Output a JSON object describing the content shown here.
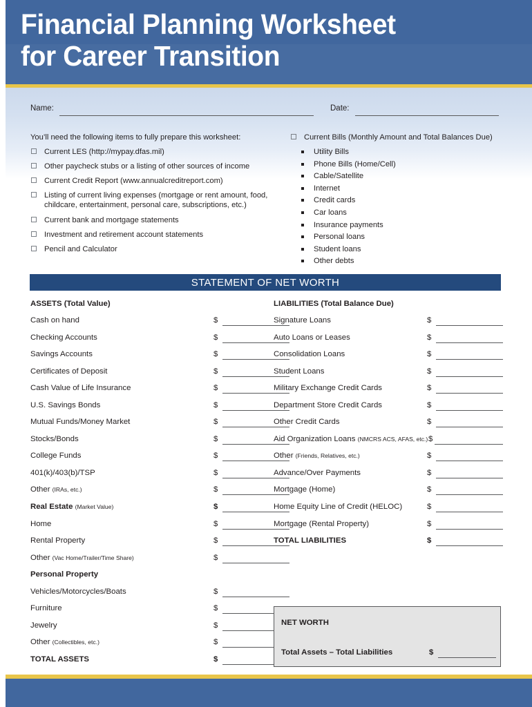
{
  "header": {
    "title": "Financial Planning Worksheet\nfor Career Transition"
  },
  "form_fields": {
    "name_label": "Name:",
    "name_value": "",
    "date_label": "Date:",
    "date_value": ""
  },
  "prep_checklist": {
    "intro": "You’ll need the following items to fully prepare this worksheet:",
    "items": [
      "Current LES (http://mypay.dfas.mil)",
      "Other paycheck stubs or a listing of other sources of income",
      "Current Credit Report (www.annualcreditreport.com)",
      "Listing of current living expenses (mortgage or rent amount, food, childcare, entertainment, personal care, subscriptions, etc.)",
      "Current bank and mortgage statements",
      "Investment and retirement account statements",
      "Pencil and Calculator"
    ]
  },
  "bills_checklist": {
    "heading": "Current Bills (Monthly Amount and Total Balances Due)",
    "items": [
      "Utility Bills",
      "Phone Bills (Home/Cell)",
      "Cable/Satellite",
      "Internet",
      "Credit cards",
      "Car loans",
      "Insurance payments",
      "Personal loans",
      "Student loans",
      "Other debts"
    ]
  },
  "statement": {
    "bar_title": "STATEMENT OF NET WORTH",
    "assets_heading": "ASSETS  (Total Value)",
    "liabilities_heading": "LIABILITIES (Total Balance Due)",
    "currency_symbol": "$",
    "assets_rows": [
      {
        "label": "Cash on hand",
        "note": "",
        "value": "",
        "bold": false,
        "money": true
      },
      {
        "label": "Checking Accounts",
        "note": "",
        "value": "",
        "bold": false,
        "money": true
      },
      {
        "label": "Savings Accounts",
        "note": "",
        "value": "",
        "bold": false,
        "money": true
      },
      {
        "label": "Certificates of Deposit",
        "note": "",
        "value": "",
        "bold": false,
        "money": true
      },
      {
        "label": "Cash Value of Life Insurance",
        "note": "",
        "value": "",
        "bold": false,
        "money": true
      },
      {
        "label": "U.S. Savings Bonds",
        "note": "",
        "value": "",
        "bold": false,
        "money": true
      },
      {
        "label": "Mutual Funds/Money Market",
        "note": "",
        "value": "",
        "bold": false,
        "money": true
      },
      {
        "label": "Stocks/Bonds",
        "note": "",
        "value": "",
        "bold": false,
        "money": true
      },
      {
        "label": "College Funds",
        "note": "",
        "value": "",
        "bold": false,
        "money": true
      },
      {
        "label": "401(k)/403(b)/TSP",
        "note": "",
        "value": "",
        "bold": false,
        "money": true
      },
      {
        "label": "Other ",
        "note": "(IRAs, etc.)",
        "value": "",
        "bold": false,
        "money": true
      },
      {
        "label": "Real Estate ",
        "note": "(Market Value)",
        "value": "",
        "bold": true,
        "money": true
      },
      {
        "label": "Home",
        "note": "",
        "value": "",
        "bold": false,
        "money": true
      },
      {
        "label": "Rental Property",
        "note": "",
        "value": "",
        "bold": false,
        "money": true
      },
      {
        "label": "Other ",
        "note": "(Vac Home/Trailer/Time Share)",
        "value": "",
        "bold": false,
        "money": true
      },
      {
        "label": "Personal Property",
        "note": "",
        "value": "",
        "bold": true,
        "money": false
      },
      {
        "label": "Vehicles/Motorcycles/Boats",
        "note": "",
        "value": "",
        "bold": false,
        "money": true
      },
      {
        "label": "Furniture",
        "note": "",
        "value": "",
        "bold": false,
        "money": true
      },
      {
        "label": "Jewelry",
        "note": "",
        "value": "",
        "bold": false,
        "money": true
      },
      {
        "label": "Other ",
        "note": "(Collectibles, etc.)",
        "value": "",
        "bold": false,
        "money": true
      },
      {
        "label": "TOTAL ASSETS",
        "note": "",
        "value": "",
        "bold": true,
        "money": true
      }
    ],
    "liabilities_rows": [
      {
        "label": "Signature Loans",
        "note": "",
        "value": "",
        "bold": false,
        "money": true,
        "long": false
      },
      {
        "label": "Auto Loans or Leases",
        "note": "",
        "value": "",
        "bold": false,
        "money": true,
        "long": false
      },
      {
        "label": "Consolidation Loans",
        "note": "",
        "value": "",
        "bold": false,
        "money": true,
        "long": false
      },
      {
        "label": "Student Loans",
        "note": "",
        "value": "",
        "bold": false,
        "money": true,
        "long": false
      },
      {
        "label": "Military Exchange Credit Cards",
        "note": "",
        "value": "",
        "bold": false,
        "money": true,
        "long": false
      },
      {
        "label": "Department Store Credit Cards",
        "note": "",
        "value": "",
        "bold": false,
        "money": true,
        "long": false
      },
      {
        "label": "Other Credit Cards",
        "note": "",
        "value": "",
        "bold": false,
        "money": true,
        "long": false
      },
      {
        "label": "Aid Organization Loans ",
        "note": "(NMCRS ACS, AFAS, etc.)",
        "value": "",
        "bold": false,
        "money": true,
        "long": true
      },
      {
        "label": "Other ",
        "note": "(Friends, Relatives, etc.)",
        "value": "",
        "bold": false,
        "money": true,
        "long": false
      },
      {
        "label": "Advance/Over Payments",
        "note": "",
        "value": "",
        "bold": false,
        "money": true,
        "long": false
      },
      {
        "label": "Mortgage (Home)",
        "note": "",
        "value": "",
        "bold": false,
        "money": true,
        "long": false
      },
      {
        "label": "Home Equity Line of Credit (HELOC)",
        "note": "",
        "value": "",
        "bold": false,
        "money": true,
        "long": false
      },
      {
        "label": "Mortgage (Rental Property)",
        "note": "",
        "value": "",
        "bold": false,
        "money": true,
        "long": false
      },
      {
        "label": "TOTAL LIABILITIES",
        "note": "",
        "value": "",
        "bold": true,
        "money": true,
        "long": false
      }
    ]
  },
  "net_worth": {
    "title": "NET WORTH",
    "formula_label": "Total Assets – Total Liabilities",
    "currency_symbol": "$",
    "value": ""
  },
  "colors": {
    "header_blue": "#41679e",
    "gold_rule": "#e8c54a",
    "section_navy": "#244a7d",
    "upper_bg_blue": "#ccd9ec",
    "box_gray": "#e4e4e4",
    "text": "#231f20"
  }
}
